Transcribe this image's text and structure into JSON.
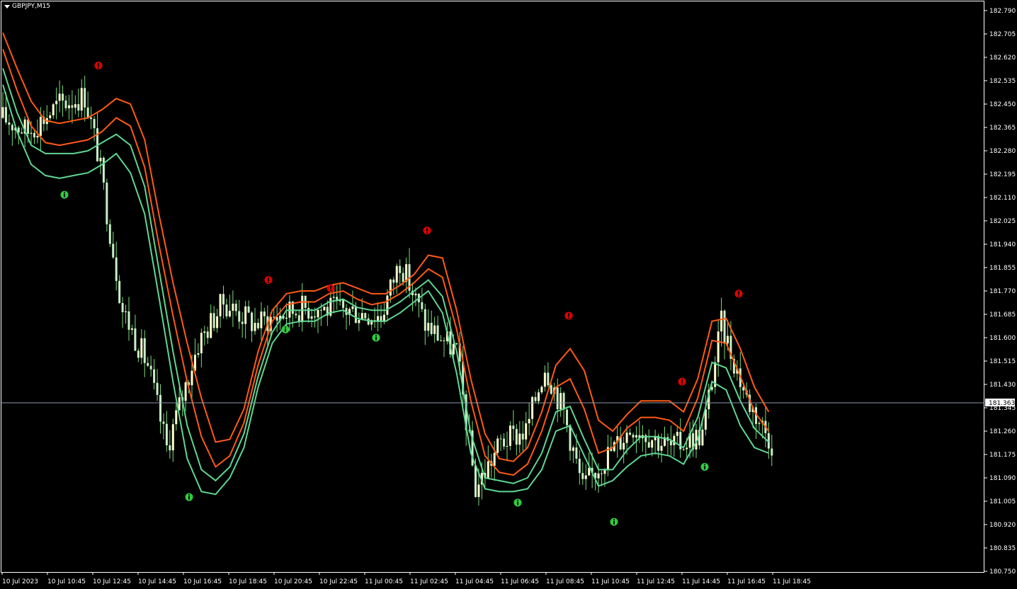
{
  "chart_title": "GBPJPY,M15",
  "current_price": "181.363",
  "price_axis": {
    "labels": [
      "182.790",
      "182.705",
      "182.620",
      "182.535",
      "182.450",
      "182.365",
      "182.280",
      "182.195",
      "182.110",
      "182.025",
      "181.940",
      "181.855",
      "181.770",
      "181.685",
      "181.600",
      "181.515",
      "181.430",
      "181.345",
      "181.260",
      "181.175",
      "181.090",
      "181.005",
      "180.920",
      "180.835",
      "180.750"
    ],
    "range": [
      180.75,
      182.79
    ]
  },
  "time_axis": {
    "labels": [
      "10 Jul 2023",
      "10 Jul 10:45",
      "10 Jul 12:45",
      "10 Jul 14:45",
      "10 Jul 16:45",
      "10 Jul 18:45",
      "10 Jul 20:45",
      "10 Jul 22:45",
      "11 Jul 00:45",
      "11 Jul 02:45",
      "11 Jul 04:45",
      "11 Jul 06:45",
      "11 Jul 08:45",
      "11 Jul 10:45",
      "11 Jul 12:45",
      "11 Jul 14:45",
      "11 Jul 16:45",
      "11 Jul 18:45"
    ]
  },
  "colors": {
    "background": "#000000",
    "bull_candle": "#ffffcc",
    "bear_candle": "#c8f0c8",
    "wick": "#7ddc7d",
    "upper_band": "#ff5a14",
    "lower_band": "#5ed692",
    "buy_arrow": "#2ecc40",
    "sell_arrow": "#e00000",
    "price_line": "#8a9aa8"
  },
  "chart_data": {
    "type": "candlestick",
    "symbol": "GBPJPY",
    "timeframe": "M15",
    "bands": {
      "upper_outer_close": [
        182.71,
        182.58,
        182.46,
        182.39,
        182.38,
        182.39,
        182.4,
        182.43,
        182.47,
        182.45,
        182.32,
        182.05,
        181.8,
        181.58,
        181.38,
        181.22,
        181.23,
        181.34,
        181.55,
        181.7,
        181.76,
        181.77,
        181.77,
        181.79,
        181.8,
        181.78,
        181.76,
        181.76,
        181.79,
        181.83,
        181.9,
        181.89,
        181.7,
        181.45,
        181.25,
        181.16,
        181.15,
        181.2,
        181.33,
        181.5,
        181.56,
        181.48,
        181.3,
        181.26,
        181.32,
        181.37,
        181.37,
        181.37,
        181.33,
        181.45,
        181.66,
        181.67,
        181.56,
        181.42,
        181.33
      ],
      "upper_mid_close": [
        182.65,
        182.5,
        182.37,
        182.31,
        182.3,
        182.31,
        182.32,
        182.35,
        182.4,
        182.37,
        182.22,
        181.94,
        181.68,
        181.44,
        181.24,
        181.13,
        181.17,
        181.29,
        181.5,
        181.66,
        181.72,
        181.73,
        181.73,
        181.76,
        181.77,
        181.74,
        181.72,
        181.73,
        181.76,
        181.8,
        181.85,
        181.82,
        181.63,
        181.37,
        181.17,
        181.11,
        181.1,
        181.14,
        181.26,
        181.42,
        181.45,
        181.34,
        181.18,
        181.2,
        181.27,
        181.31,
        181.31,
        181.3,
        181.26,
        181.38,
        181.59,
        181.58,
        181.46,
        181.33,
        181.26
      ],
      "lower_mid_close": [
        182.58,
        182.42,
        182.3,
        182.27,
        182.27,
        182.27,
        182.28,
        182.31,
        182.34,
        182.3,
        182.15,
        181.85,
        181.55,
        181.28,
        181.12,
        181.08,
        181.13,
        181.25,
        181.46,
        181.62,
        181.7,
        181.7,
        181.7,
        181.73,
        181.74,
        181.71,
        181.7,
        181.7,
        181.73,
        181.77,
        181.81,
        181.75,
        181.55,
        181.25,
        181.09,
        181.08,
        181.07,
        181.09,
        181.18,
        181.33,
        181.35,
        181.23,
        181.12,
        181.12,
        181.19,
        181.24,
        181.24,
        181.23,
        181.2,
        181.31,
        181.51,
        181.49,
        181.37,
        181.27,
        181.22
      ],
      "lower_outer_close": [
        182.52,
        182.35,
        182.23,
        182.19,
        182.18,
        182.19,
        182.2,
        182.23,
        182.27,
        182.2,
        182.05,
        181.75,
        181.44,
        181.16,
        181.04,
        181.03,
        181.09,
        181.2,
        181.42,
        181.58,
        181.65,
        181.66,
        181.66,
        181.69,
        181.7,
        181.67,
        181.66,
        181.66,
        181.69,
        181.73,
        181.77,
        181.69,
        181.47,
        181.18,
        181.05,
        181.04,
        181.04,
        181.05,
        181.12,
        181.26,
        181.28,
        181.17,
        181.06,
        181.08,
        181.13,
        181.17,
        181.18,
        181.17,
        181.14,
        181.23,
        181.44,
        181.41,
        181.28,
        181.2,
        181.18
      ]
    },
    "sell_signals": [
      182.59,
      181.81,
      181.78,
      181.99,
      181.68,
      181.44,
      181.76
    ],
    "buy_signals": [
      182.12,
      181.02,
      181.63,
      181.6,
      181.0,
      180.93,
      181.13
    ]
  }
}
